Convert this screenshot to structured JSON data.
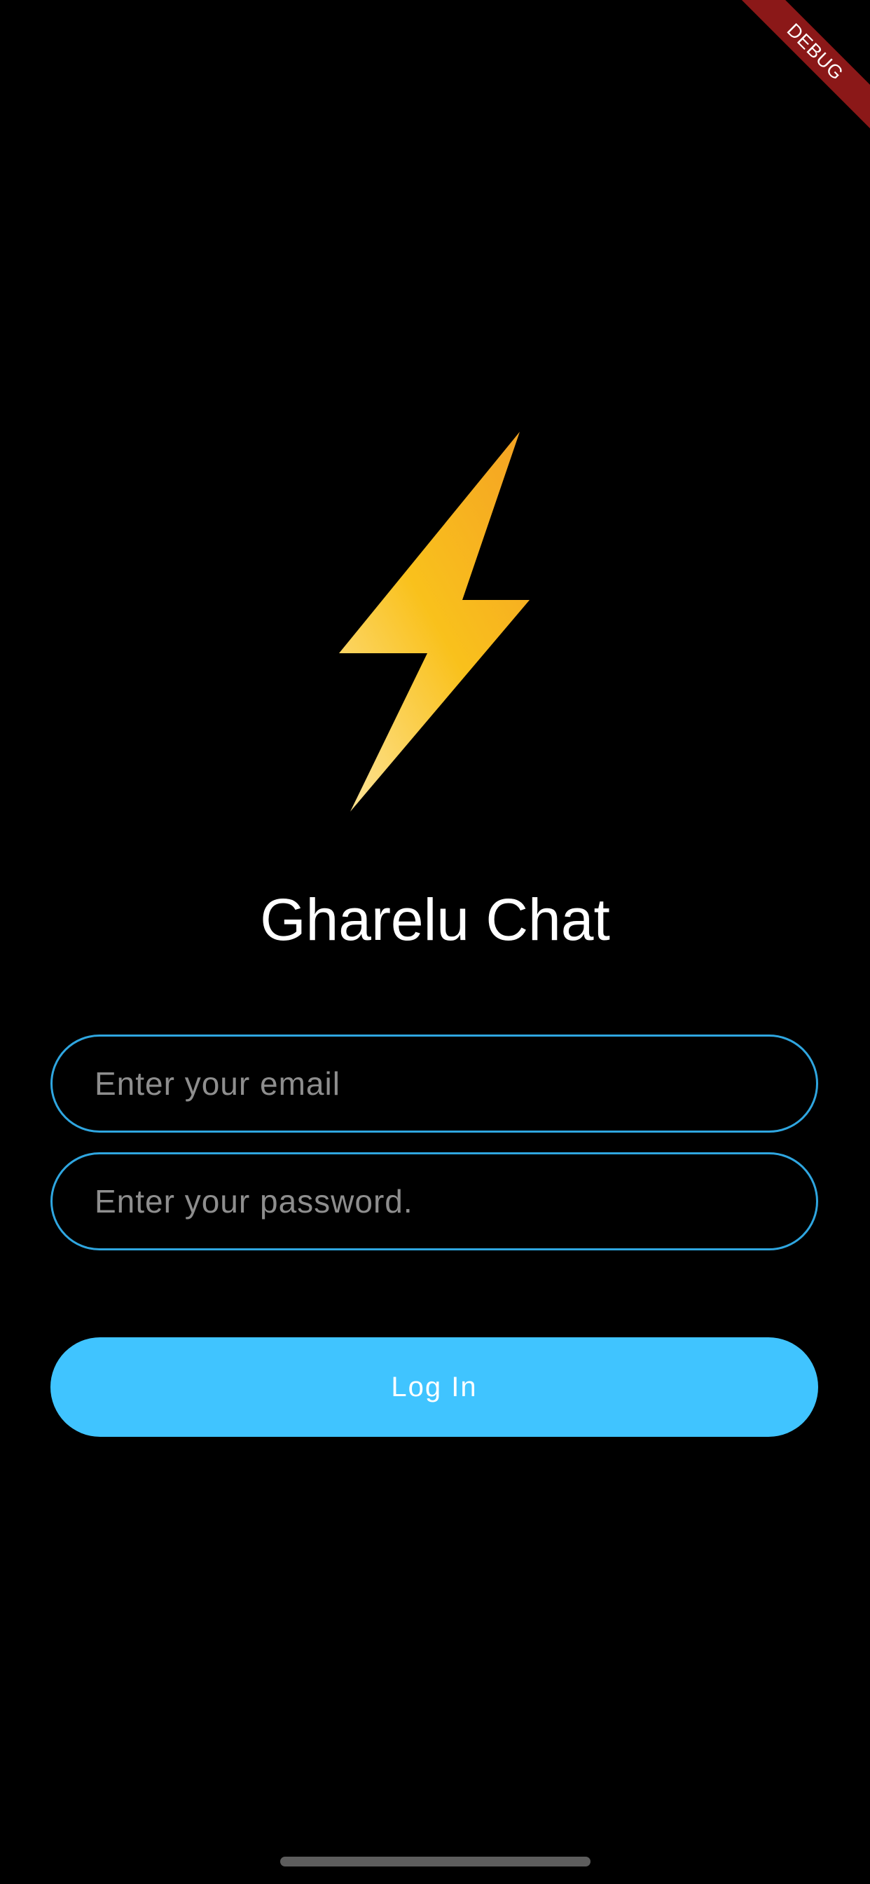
{
  "debug_banner": {
    "label": "DEBUG",
    "color": "#8b1818"
  },
  "logo": {
    "icon": "lightning-bolt-icon",
    "colors": [
      "#f5a623",
      "#f9c11c",
      "#fde08a"
    ]
  },
  "app": {
    "title": "Gharelu Chat"
  },
  "form": {
    "email": {
      "placeholder": "Enter your email",
      "value": ""
    },
    "password": {
      "placeholder": "Enter your password.",
      "value": ""
    },
    "border_color": "#2fa6e0"
  },
  "login_button": {
    "label": "Log In",
    "color": "#40c4ff"
  }
}
